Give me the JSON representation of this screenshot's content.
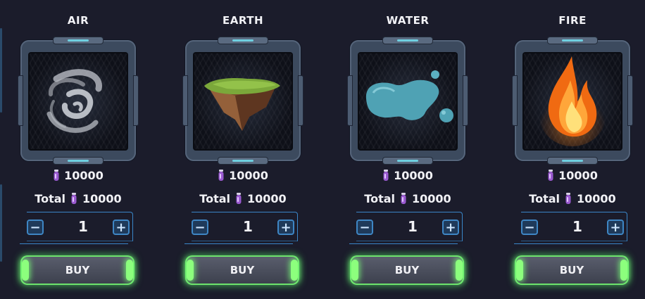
{
  "cards": [
    {
      "title": "AIR",
      "price": "10000",
      "total_label": "Total",
      "total": "10000",
      "quantity": "1",
      "minus": "−",
      "plus": "+",
      "buy_label": "BUY",
      "art": "whirlwind"
    },
    {
      "title": "EARTH",
      "price": "10000",
      "total_label": "Total",
      "total": "10000",
      "quantity": "1",
      "minus": "−",
      "plus": "+",
      "buy_label": "BUY",
      "art": "floating-island"
    },
    {
      "title": "WATER",
      "price": "10000",
      "total_label": "Total",
      "total": "10000",
      "quantity": "1",
      "minus": "−",
      "plus": "+",
      "buy_label": "BUY",
      "art": "water-blob"
    },
    {
      "title": "FIRE",
      "price": "10000",
      "total_label": "Total",
      "total": "10000",
      "quantity": "1",
      "minus": "−",
      "plus": "+",
      "buy_label": "BUY",
      "art": "flame"
    }
  ],
  "currency_icon": "purple-vial-icon",
  "colors": {
    "background": "#1b1c2b",
    "accent_blue": "#3e86c4",
    "buy_glow": "#6de36c",
    "vial": "#9a5ad0"
  }
}
